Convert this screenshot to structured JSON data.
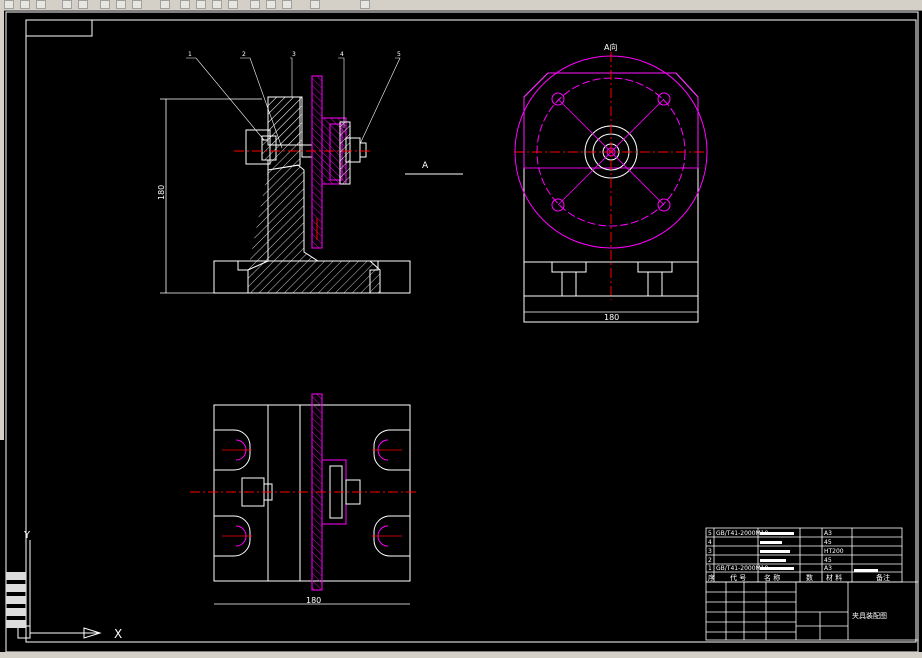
{
  "drawing": {
    "view_label_top": "A向",
    "section_label": "A",
    "front_dimension": "180",
    "side_dimension": "180",
    "bottom_dimension": "180",
    "leaders": [
      "1",
      "2",
      "3",
      "4",
      "5"
    ]
  },
  "title_block": {
    "rows": [
      {
        "no": "5",
        "code": "GB/T41-2000M10",
        "qty": "",
        "mat": "A3"
      },
      {
        "no": "4",
        "code": "",
        "qty": "",
        "mat": "45"
      },
      {
        "no": "3",
        "code": "",
        "qty": "",
        "mat": "HT200"
      },
      {
        "no": "2",
        "code": "",
        "qty": "",
        "mat": "45"
      },
      {
        "no": "1",
        "code": "GB/T41-2000M10",
        "qty": "",
        "mat": "A3"
      }
    ],
    "header": {
      "no": "序",
      "code": "代 号",
      "name": "名 称",
      "qty": "数",
      "mat": "材 料",
      "note": "备注"
    },
    "drawing_name": "夹具装配图"
  },
  "ucs": {
    "x_label": "X",
    "y_label": "Y"
  },
  "colors": {
    "outline": "#ffffff",
    "hatch": "#ffffff",
    "plate": "#ff00ff",
    "centerline": "#ff0000",
    "background": "#000000"
  }
}
